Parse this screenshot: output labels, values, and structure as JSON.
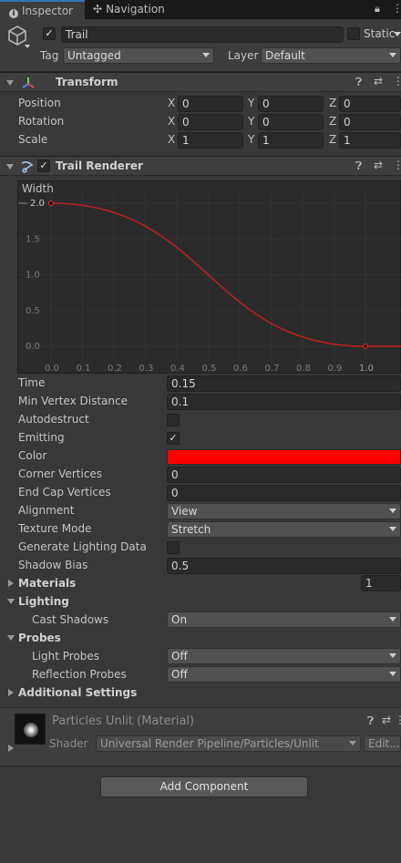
{
  "tabs": [
    {
      "label": "Inspector",
      "icon": "info-icon"
    },
    {
      "label": "Navigation",
      "icon": "navigation-icon"
    }
  ],
  "gameobject": {
    "active": true,
    "name": "Trail",
    "static_label": "Static",
    "tag_label": "Tag",
    "tag_value": "Untagged",
    "layer_label": "Layer",
    "layer_value": "Default"
  },
  "transform": {
    "title": "Transform",
    "rows": [
      {
        "label": "Position",
        "x": "0",
        "y": "0",
        "z": "0"
      },
      {
        "label": "Rotation",
        "x": "0",
        "y": "0",
        "z": "0"
      },
      {
        "label": "Scale",
        "x": "1",
        "y": "1",
        "z": "1"
      }
    ],
    "axis_labels": [
      "X",
      "Y",
      "Z"
    ]
  },
  "trail": {
    "title": "Trail Renderer",
    "enabled": true,
    "width_label": "Width",
    "width_value": "2.0",
    "curve": {
      "x_ticks": [
        "0.0",
        "0.1",
        "0.2",
        "0.3",
        "0.4",
        "0.5",
        "0.6",
        "0.7",
        "0.8",
        "0.9",
        "1.0"
      ],
      "y_ticks": [
        "1.5",
        "1.0",
        "0.5",
        "0.0"
      ],
      "keys": [
        [
          0.0,
          2.0
        ],
        [
          1.0,
          0.0
        ]
      ],
      "curve_color": "#c0201c"
    },
    "props": [
      {
        "label": "Time",
        "type": "field",
        "value": "0.15"
      },
      {
        "label": "Min Vertex Distance",
        "type": "field",
        "value": "0.1"
      },
      {
        "label": "Autodestruct",
        "type": "checkbox",
        "checked": false
      },
      {
        "label": "Emitting",
        "type": "checkbox",
        "checked": true
      },
      {
        "label": "Color",
        "type": "color",
        "color": "#ff0000"
      },
      {
        "label": "Corner Vertices",
        "type": "field",
        "value": "0"
      },
      {
        "label": "End Cap Vertices",
        "type": "field",
        "value": "0"
      },
      {
        "label": "Alignment",
        "type": "dropdown",
        "value": "View"
      },
      {
        "label": "Texture Mode",
        "type": "dropdown",
        "value": "Stretch"
      },
      {
        "label": "Generate Lighting Data",
        "type": "checkbox",
        "checked": false
      },
      {
        "label": "Shadow Bias",
        "type": "field",
        "value": "0.5"
      }
    ],
    "materials_label": "Materials",
    "materials_count": "1",
    "lighting_label": "Lighting",
    "cast_shadows_label": "Cast Shadows",
    "cast_shadows_value": "On",
    "probes_label": "Probes",
    "light_probes_label": "Light Probes",
    "light_probes_value": "Off",
    "reflection_probes_label": "Reflection Probes",
    "reflection_probes_value": "Off",
    "additional_label": "Additional Settings"
  },
  "material": {
    "title": "Particles Unlit (Material)",
    "shader_label": "Shader",
    "shader_value": "Universal Render Pipeline/Particles/Unlit",
    "edit_label": "Edit..."
  },
  "add_component_label": "Add Component"
}
